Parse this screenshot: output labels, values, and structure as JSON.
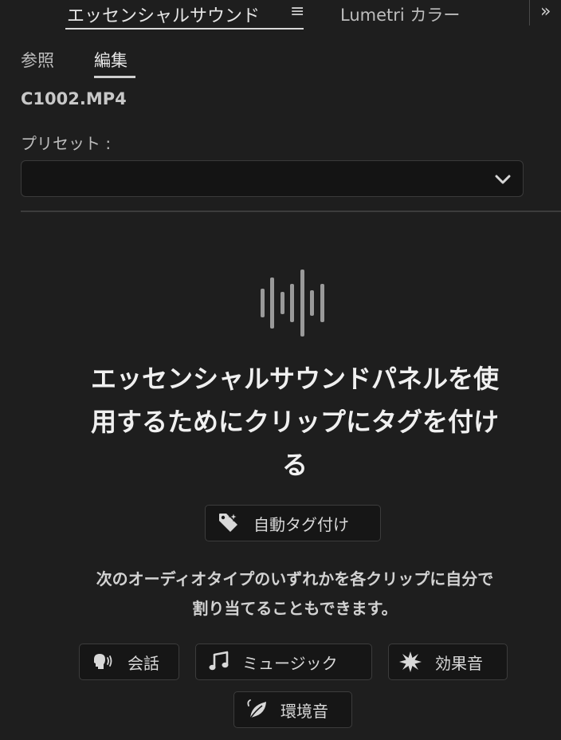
{
  "tabs": {
    "essential_sound": "エッセンシャルサウンド",
    "menu_glyph": "≡",
    "lumetri": "Lumetri カラー",
    "overflow_glyph": "»"
  },
  "subtabs": {
    "reference": "参照",
    "edit": "編集"
  },
  "clip_name": "C1002.MP4",
  "preset": {
    "label": "プリセット :",
    "value": ""
  },
  "empty_state": {
    "headline_lines": [
      "エッセンシャルサウンドパネルを使",
      "用するためにクリップにタグを付け",
      "る"
    ],
    "auto_tag_button": "自動タグ付け",
    "description_lines": [
      "次のオーディオタイプのいずれかを各クリップに自分で",
      "割り当てることもできます。"
    ]
  },
  "audio_types": {
    "dialogue": "会話",
    "music": "ミュージック",
    "sfx": "効果音",
    "ambience": "環境音"
  },
  "colors": {
    "background": "#1e1e1e",
    "input_background": "#141414",
    "text_primary": "#f0f0f0",
    "text_secondary": "#bdbdbd",
    "border": "#3c3c3c"
  }
}
